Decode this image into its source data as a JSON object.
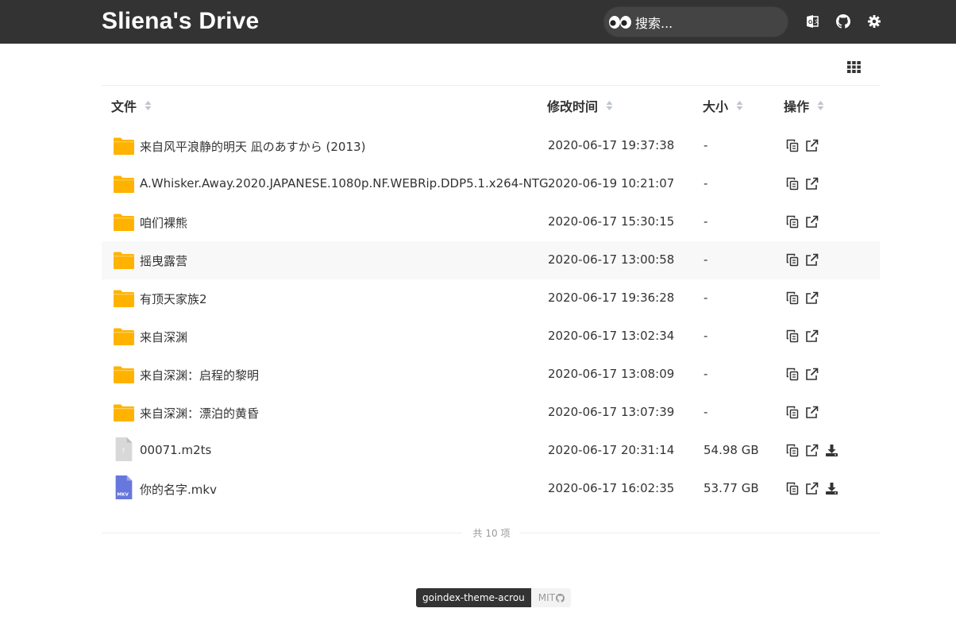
{
  "header": {
    "title": "Sliena's Drive",
    "search_placeholder": "搜索...",
    "icons": [
      "eyes-icon",
      "translate-icon",
      "github-icon",
      "gear-icon"
    ]
  },
  "toolbar": {
    "view_toggle_icon": "grid-icon"
  },
  "table": {
    "columns": [
      "文件",
      "修改时间",
      "大小",
      "操作"
    ],
    "rows": [
      {
        "name": "来自风平浪静的明天 凪のあすから (2013)",
        "modified": "2020-06-17 19:37:38",
        "size": "-",
        "type": "folder"
      },
      {
        "name": "A.Whisker.Away.2020.JAPANESE.1080p.NF.WEBRip.DDP5.1.x264-NTG",
        "modified": "2020-06-19 10:21:07",
        "size": "-",
        "type": "folder"
      },
      {
        "name": "咱们裸熊",
        "modified": "2020-06-17 15:30:15",
        "size": "-",
        "type": "folder"
      },
      {
        "name": "摇曳露营",
        "modified": "2020-06-17 13:00:58",
        "size": "-",
        "type": "folder"
      },
      {
        "name": "有顶天家族2",
        "modified": "2020-06-17 19:36:28",
        "size": "-",
        "type": "folder"
      },
      {
        "name": "来自深渊",
        "modified": "2020-06-17 13:02:34",
        "size": "-",
        "type": "folder"
      },
      {
        "name": "来自深渊：启程的黎明",
        "modified": "2020-06-17 13:08:09",
        "size": "-",
        "type": "folder"
      },
      {
        "name": "来自深渊：漂泊的黄昏",
        "modified": "2020-06-17 13:07:39",
        "size": "-",
        "type": "folder"
      },
      {
        "name": "00071.m2ts",
        "modified": "2020-06-17 20:31:14",
        "size": "54.98 GB",
        "type": "unknown-file"
      },
      {
        "name": "你的名字.mkv",
        "modified": "2020-06-17 16:02:35",
        "size": "53.77 GB",
        "type": "mkv-file",
        "icon_label": "MKV"
      }
    ],
    "highlight_row": 3,
    "accent_folder": "#FFB300",
    "accent_mkv": "#6677DD"
  },
  "footer": {
    "total": "共 10 项",
    "badge_left": "goindex-theme-acrou",
    "badge_right": "MIT"
  }
}
